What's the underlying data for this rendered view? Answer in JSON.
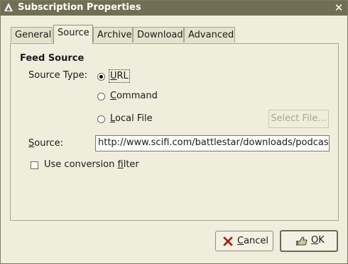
{
  "window": {
    "title": "Subscription Properties"
  },
  "tabs": [
    {
      "label": "General"
    },
    {
      "label": "Source"
    },
    {
      "label": "Archive"
    },
    {
      "label": "Download"
    },
    {
      "label": "Advanced"
    }
  ],
  "active_tab": "Source",
  "feed_source": {
    "heading": "Feed Source",
    "source_type_label": "Source Type:",
    "options": [
      {
        "label": "URL",
        "checked": true
      },
      {
        "label": "Command",
        "checked": false
      },
      {
        "label": "Local File",
        "checked": false
      }
    ],
    "select_file_label": "Select File...",
    "source_label": "Source:",
    "source_value": "http://www.scifi.com/battlestar/downloads/podcast/p",
    "conversion_filter_label": "Use conversion filter",
    "conversion_filter_checked": false
  },
  "buttons": {
    "cancel": "Cancel",
    "ok": "OK"
  },
  "colors": {
    "titlebar": "#706f55",
    "background": "#efeedd"
  }
}
